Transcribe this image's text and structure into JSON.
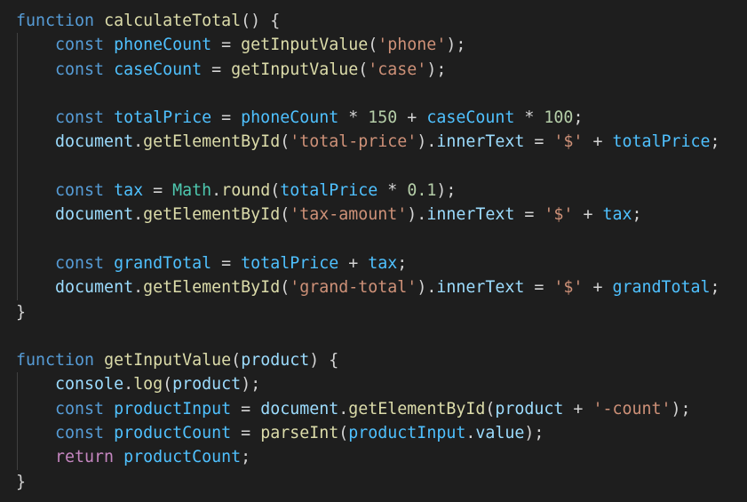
{
  "editor": {
    "language": "javascript",
    "theme": {
      "background": "#1e1e1e",
      "default": "#d4d4d4",
      "keyword": "#569cd6",
      "control": "#c586c0",
      "function": "#dcdcaa",
      "variable": "#9cdcfe",
      "constant": "#4fc1ff",
      "string": "#ce9178",
      "number": "#b5cea8",
      "class": "#4ec9b0",
      "indent_guide": "#404040"
    },
    "lines": [
      {
        "indent": 0,
        "tokens": [
          [
            "function",
            "keyword"
          ],
          [
            " ",
            "default"
          ],
          [
            "calculateTotal",
            "function"
          ],
          [
            "() {",
            "default"
          ]
        ]
      },
      {
        "indent": 1,
        "tokens": [
          [
            "const",
            "keyword"
          ],
          [
            " ",
            "default"
          ],
          [
            "phoneCount",
            "constant"
          ],
          [
            " = ",
            "default"
          ],
          [
            "getInputValue",
            "function"
          ],
          [
            "(",
            "default"
          ],
          [
            "'phone'",
            "string"
          ],
          [
            ");",
            "default"
          ]
        ]
      },
      {
        "indent": 1,
        "tokens": [
          [
            "const",
            "keyword"
          ],
          [
            " ",
            "default"
          ],
          [
            "caseCount",
            "constant"
          ],
          [
            " = ",
            "default"
          ],
          [
            "getInputValue",
            "function"
          ],
          [
            "(",
            "default"
          ],
          [
            "'case'",
            "string"
          ],
          [
            ");",
            "default"
          ]
        ]
      },
      {
        "indent": 1,
        "tokens": []
      },
      {
        "indent": 1,
        "tokens": [
          [
            "const",
            "keyword"
          ],
          [
            " ",
            "default"
          ],
          [
            "totalPrice",
            "constant"
          ],
          [
            " = ",
            "default"
          ],
          [
            "phoneCount",
            "constant"
          ],
          [
            " * ",
            "default"
          ],
          [
            "150",
            "number"
          ],
          [
            " + ",
            "default"
          ],
          [
            "caseCount",
            "constant"
          ],
          [
            " * ",
            "default"
          ],
          [
            "100",
            "number"
          ],
          [
            ";",
            "default"
          ]
        ]
      },
      {
        "indent": 1,
        "tokens": [
          [
            "document",
            "variable"
          ],
          [
            ".",
            "default"
          ],
          [
            "getElementById",
            "function"
          ],
          [
            "(",
            "default"
          ],
          [
            "'total-price'",
            "string"
          ],
          [
            ").",
            "default"
          ],
          [
            "innerText",
            "variable"
          ],
          [
            " = ",
            "default"
          ],
          [
            "'$'",
            "string"
          ],
          [
            " + ",
            "default"
          ],
          [
            "totalPrice",
            "constant"
          ],
          [
            ";",
            "default"
          ]
        ]
      },
      {
        "indent": 1,
        "tokens": []
      },
      {
        "indent": 1,
        "tokens": [
          [
            "const",
            "keyword"
          ],
          [
            " ",
            "default"
          ],
          [
            "tax",
            "constant"
          ],
          [
            " = ",
            "default"
          ],
          [
            "Math",
            "class"
          ],
          [
            ".",
            "default"
          ],
          [
            "round",
            "function"
          ],
          [
            "(",
            "default"
          ],
          [
            "totalPrice",
            "constant"
          ],
          [
            " * ",
            "default"
          ],
          [
            "0.1",
            "number"
          ],
          [
            ");",
            "default"
          ]
        ]
      },
      {
        "indent": 1,
        "tokens": [
          [
            "document",
            "variable"
          ],
          [
            ".",
            "default"
          ],
          [
            "getElementById",
            "function"
          ],
          [
            "(",
            "default"
          ],
          [
            "'tax-amount'",
            "string"
          ],
          [
            ").",
            "default"
          ],
          [
            "innerText",
            "variable"
          ],
          [
            " = ",
            "default"
          ],
          [
            "'$'",
            "string"
          ],
          [
            " + ",
            "default"
          ],
          [
            "tax",
            "constant"
          ],
          [
            ";",
            "default"
          ]
        ]
      },
      {
        "indent": 1,
        "tokens": []
      },
      {
        "indent": 1,
        "tokens": [
          [
            "const",
            "keyword"
          ],
          [
            " ",
            "default"
          ],
          [
            "grandTotal",
            "constant"
          ],
          [
            " = ",
            "default"
          ],
          [
            "totalPrice",
            "constant"
          ],
          [
            " + ",
            "default"
          ],
          [
            "tax",
            "constant"
          ],
          [
            ";",
            "default"
          ]
        ]
      },
      {
        "indent": 1,
        "tokens": [
          [
            "document",
            "variable"
          ],
          [
            ".",
            "default"
          ],
          [
            "getElementById",
            "function"
          ],
          [
            "(",
            "default"
          ],
          [
            "'grand-total'",
            "string"
          ],
          [
            ").",
            "default"
          ],
          [
            "innerText",
            "variable"
          ],
          [
            " = ",
            "default"
          ],
          [
            "'$'",
            "string"
          ],
          [
            " + ",
            "default"
          ],
          [
            "grandTotal",
            "constant"
          ],
          [
            ";",
            "default"
          ]
        ]
      },
      {
        "indent": 0,
        "tokens": [
          [
            "}",
            "default"
          ]
        ]
      },
      {
        "indent": 0,
        "tokens": []
      },
      {
        "indent": 0,
        "tokens": [
          [
            "function",
            "keyword"
          ],
          [
            " ",
            "default"
          ],
          [
            "getInputValue",
            "function"
          ],
          [
            "(",
            "default"
          ],
          [
            "product",
            "variable"
          ],
          [
            ") {",
            "default"
          ]
        ]
      },
      {
        "indent": 1,
        "tokens": [
          [
            "console",
            "variable"
          ],
          [
            ".",
            "default"
          ],
          [
            "log",
            "function"
          ],
          [
            "(",
            "default"
          ],
          [
            "product",
            "variable"
          ],
          [
            ");",
            "default"
          ]
        ]
      },
      {
        "indent": 1,
        "tokens": [
          [
            "const",
            "keyword"
          ],
          [
            " ",
            "default"
          ],
          [
            "productInput",
            "constant"
          ],
          [
            " = ",
            "default"
          ],
          [
            "document",
            "variable"
          ],
          [
            ".",
            "default"
          ],
          [
            "getElementById",
            "function"
          ],
          [
            "(",
            "default"
          ],
          [
            "product",
            "variable"
          ],
          [
            " + ",
            "default"
          ],
          [
            "'-count'",
            "string"
          ],
          [
            ");",
            "default"
          ]
        ]
      },
      {
        "indent": 1,
        "tokens": [
          [
            "const",
            "keyword"
          ],
          [
            " ",
            "default"
          ],
          [
            "productCount",
            "constant"
          ],
          [
            " = ",
            "default"
          ],
          [
            "parseInt",
            "function"
          ],
          [
            "(",
            "default"
          ],
          [
            "productInput",
            "constant"
          ],
          [
            ".",
            "default"
          ],
          [
            "value",
            "variable"
          ],
          [
            ");",
            "default"
          ]
        ]
      },
      {
        "indent": 1,
        "tokens": [
          [
            "return",
            "control"
          ],
          [
            " ",
            "default"
          ],
          [
            "productCount",
            "constant"
          ],
          [
            ";",
            "default"
          ]
        ]
      },
      {
        "indent": 0,
        "tokens": [
          [
            "}",
            "default"
          ]
        ]
      }
    ]
  }
}
